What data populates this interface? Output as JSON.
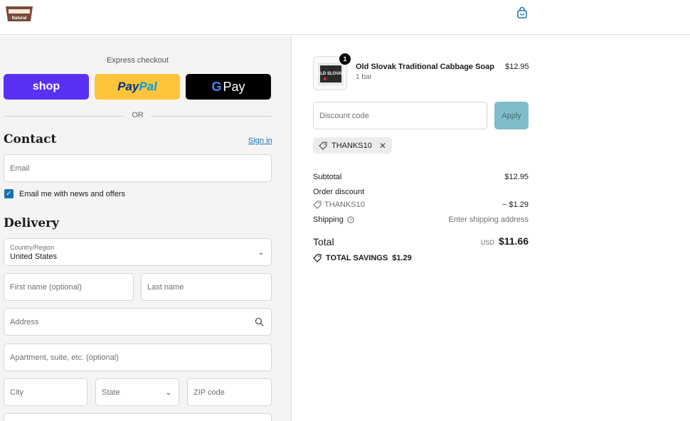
{
  "header": {
    "logo_icon": "brand-logo",
    "logo_text": "Natural",
    "cart_icon": "shopping-bag-icon"
  },
  "express": {
    "title": "Express checkout",
    "shop_label": "shop",
    "paypal_label_1": "Pay",
    "paypal_label_2": "Pal",
    "gpay_g": "G",
    "gpay_label": "Pay",
    "or_text": "OR"
  },
  "contact": {
    "title": "Contact",
    "signin_label": "Sign in",
    "email_placeholder": "Email",
    "news_label": "Email me with news and offers",
    "news_checked": true
  },
  "delivery": {
    "title": "Delivery",
    "country_label": "Country/Region",
    "country_value": "United States",
    "first_name_placeholder": "First name (optional)",
    "last_name_placeholder": "Last name",
    "address_placeholder": "Address",
    "apartment_placeholder": "Apartment, suite, etc. (optional)",
    "city_placeholder": "City",
    "state_placeholder": "State",
    "zip_placeholder": "ZIP code"
  },
  "summary": {
    "item": {
      "quantity": "1",
      "name": "Old Slovak Traditional Cabbage Soap",
      "variant": "1 bar",
      "price": "$12.95",
      "thumb_text": "OLD SLOVAK"
    },
    "discount_placeholder": "Discount code",
    "apply_label": "Apply",
    "code_chip": "THANKS10",
    "subtotal_label": "Subtotal",
    "subtotal_value": "$12.95",
    "order_discount_label": "Order discount",
    "discount_code": "THANKS10",
    "discount_value": "− $1.29",
    "shipping_label": "Shipping",
    "shipping_value": "Enter shipping address",
    "total_label": "Total",
    "total_currency": "USD",
    "total_value": "$11.66",
    "savings_label": "TOTAL SAVINGS",
    "savings_value": "$1.29"
  },
  "colors": {
    "shop": "#5a31f4",
    "paypal": "#ffc439",
    "gpay": "#000000",
    "link": "#1773b0",
    "apply": "#7fbdca"
  }
}
